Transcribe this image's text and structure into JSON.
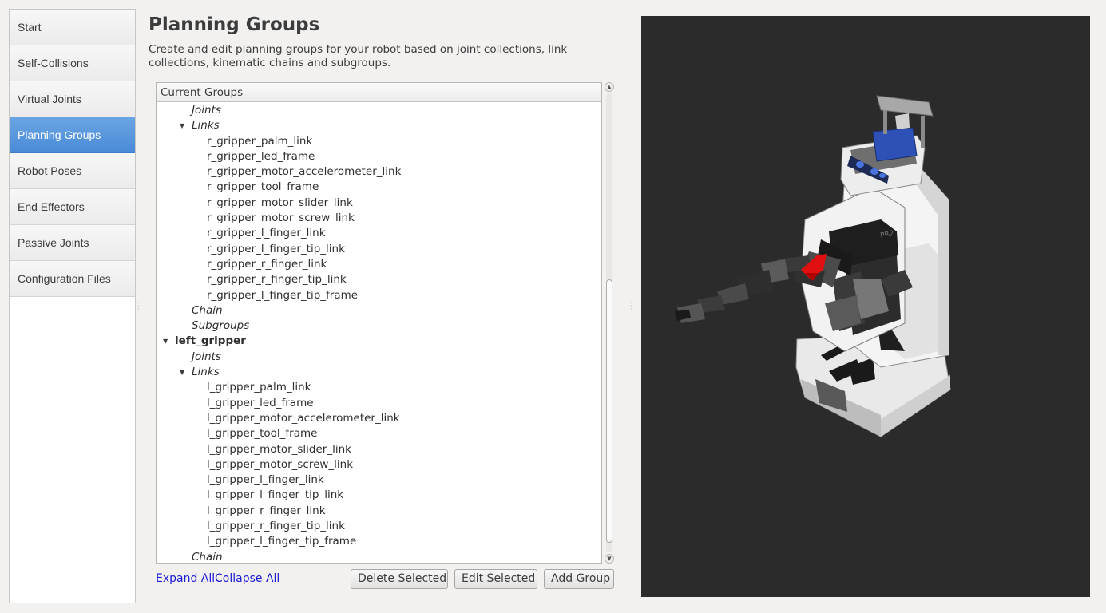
{
  "sidebar": {
    "items": [
      {
        "label": "Start",
        "active": false
      },
      {
        "label": "Self-Collisions",
        "active": false
      },
      {
        "label": "Virtual Joints",
        "active": false
      },
      {
        "label": "Planning Groups",
        "active": true
      },
      {
        "label": "Robot Poses",
        "active": false
      },
      {
        "label": "End Effectors",
        "active": false
      },
      {
        "label": "Passive Joints",
        "active": false
      },
      {
        "label": "Configuration Files",
        "active": false
      }
    ],
    "active_color": "#4a8bd8"
  },
  "main": {
    "title": "Planning Groups",
    "description": "Create and edit planning groups for your robot based on joint collections, link collections, kinematic chains and subgroups.",
    "tree": {
      "header": "Current Groups",
      "rows": [
        {
          "level": "cat",
          "label": "Joints",
          "expanded": null
        },
        {
          "level": "cat",
          "label": "Links",
          "expanded": true
        },
        {
          "level": "leaf",
          "label": "r_gripper_palm_link"
        },
        {
          "level": "leaf",
          "label": "r_gripper_led_frame"
        },
        {
          "level": "leaf",
          "label": "r_gripper_motor_accelerometer_link"
        },
        {
          "level": "leaf",
          "label": "r_gripper_tool_frame"
        },
        {
          "level": "leaf",
          "label": "r_gripper_motor_slider_link"
        },
        {
          "level": "leaf",
          "label": "r_gripper_motor_screw_link"
        },
        {
          "level": "leaf",
          "label": "r_gripper_l_finger_link"
        },
        {
          "level": "leaf",
          "label": "r_gripper_l_finger_tip_link"
        },
        {
          "level": "leaf",
          "label": "r_gripper_r_finger_link"
        },
        {
          "level": "leaf",
          "label": "r_gripper_r_finger_tip_link"
        },
        {
          "level": "leaf",
          "label": "r_gripper_l_finger_tip_frame"
        },
        {
          "level": "cat",
          "label": "Chain",
          "expanded": null
        },
        {
          "level": "cat",
          "label": "Subgroups",
          "expanded": null
        },
        {
          "level": "group",
          "label": "left_gripper",
          "expanded": true
        },
        {
          "level": "cat",
          "label": "Joints",
          "expanded": null
        },
        {
          "level": "cat",
          "label": "Links",
          "expanded": true
        },
        {
          "level": "leaf",
          "label": "l_gripper_palm_link"
        },
        {
          "level": "leaf",
          "label": "l_gripper_led_frame"
        },
        {
          "level": "leaf",
          "label": "l_gripper_motor_accelerometer_link"
        },
        {
          "level": "leaf",
          "label": "l_gripper_tool_frame"
        },
        {
          "level": "leaf",
          "label": "l_gripper_motor_slider_link"
        },
        {
          "level": "leaf",
          "label": "l_gripper_motor_screw_link"
        },
        {
          "level": "leaf",
          "label": "l_gripper_l_finger_link"
        },
        {
          "level": "leaf",
          "label": "l_gripper_l_finger_tip_link"
        },
        {
          "level": "leaf",
          "label": "l_gripper_r_finger_link"
        },
        {
          "level": "leaf",
          "label": "l_gripper_r_finger_tip_link"
        },
        {
          "level": "leaf",
          "label": "l_gripper_l_finger_tip_frame"
        },
        {
          "level": "cat",
          "label": "Chain",
          "expanded": null
        }
      ]
    },
    "links": {
      "expand_all": "Expand All",
      "collapse_all": "Collapse All"
    },
    "buttons": {
      "delete": "Delete Selected",
      "edit": "Edit Selected",
      "add": "Add Group"
    }
  },
  "viewport": {
    "background": "#2b2b2b",
    "robot_label": "PR2",
    "highlight_color": "#e01010"
  }
}
